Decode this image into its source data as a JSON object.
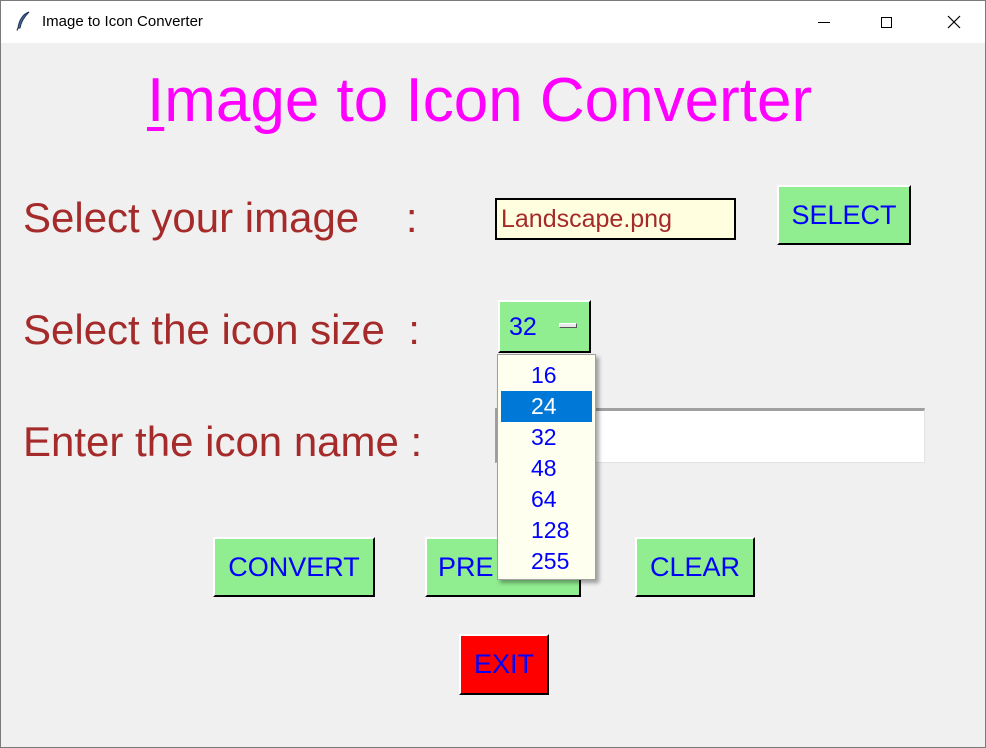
{
  "window": {
    "title": "Image to Icon Converter",
    "icon": "feather-icon",
    "controls": [
      "minimize-icon",
      "maximize-icon",
      "close-icon"
    ]
  },
  "heading": {
    "first_letter": "I",
    "rest": "mage to Icon Converter",
    "color": "#ff00ff"
  },
  "labels": {
    "select_image": "Select your image    :",
    "select_size": "Select the icon size  :",
    "icon_name": "Enter the icon name :",
    "color": "#a52a2a"
  },
  "file_field": {
    "value": "Landscape.png"
  },
  "buttons": {
    "select": "SELECT",
    "convert": "CONVERT",
    "preview_visible": "PRE",
    "clear": "CLEAR",
    "exit": "EXIT"
  },
  "size_menu": {
    "selected": "32",
    "options": [
      "16",
      "24",
      "32",
      "48",
      "64",
      "128",
      "255"
    ],
    "highlighted": "24"
  },
  "icon_name_entry": {
    "value": ""
  },
  "colors": {
    "button_green": "#90ee90",
    "button_text": "#0000ff",
    "exit_red": "#ff0000",
    "file_field_bg": "#ffffe0",
    "menu_bg": "#fffff0",
    "menu_highlight": "#0078d7"
  }
}
